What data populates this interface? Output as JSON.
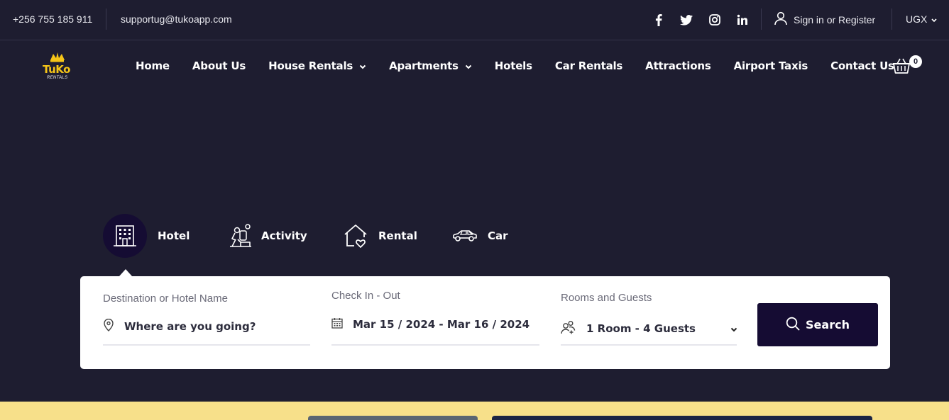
{
  "topbar": {
    "phone": "+256 755 185 911",
    "email": "supportug@tukoapp.com",
    "social": [
      "facebook-icon",
      "twitter-icon",
      "instagram-icon",
      "linkedin-icon"
    ],
    "signin_label": "Sign in or Register",
    "currency": "UGX"
  },
  "brand": {
    "logo_text": "TuKo",
    "logo_sub": "RENTALS",
    "accent": "#f5c518"
  },
  "nav": {
    "items": [
      {
        "label": "Home",
        "dropdown": false
      },
      {
        "label": "About Us",
        "dropdown": false
      },
      {
        "label": "House Rentals",
        "dropdown": true
      },
      {
        "label": "Apartments",
        "dropdown": true
      },
      {
        "label": "Hotels",
        "dropdown": false
      },
      {
        "label": "Car Rentals",
        "dropdown": false
      },
      {
        "label": "Attractions",
        "dropdown": false
      },
      {
        "label": "Airport Taxis",
        "dropdown": false
      },
      {
        "label": "Contact Us",
        "dropdown": false
      }
    ],
    "cart_count": "0"
  },
  "tabs": [
    {
      "label": "Hotel",
      "icon": "hotel-icon",
      "active": true
    },
    {
      "label": "Activity",
      "icon": "activity-icon",
      "active": false
    },
    {
      "label": "Rental",
      "icon": "rental-house-icon",
      "active": false
    },
    {
      "label": "Car",
      "icon": "car-icon",
      "active": false
    }
  ],
  "search": {
    "destination_label": "Destination or Hotel Name",
    "destination_value": "Where are you going?",
    "checkin_label": "Check In - Out",
    "checkin_value": "Mar 15 / 2024 - Mar 16 / 2024",
    "rooms_label": "Rooms and Guests",
    "rooms_value": "1 Room - 4 Guests",
    "button_label": "Search"
  },
  "colors": {
    "background": "#1e1d30",
    "primary_dark": "#150c33",
    "yellow_strip": "#f7e08a"
  }
}
